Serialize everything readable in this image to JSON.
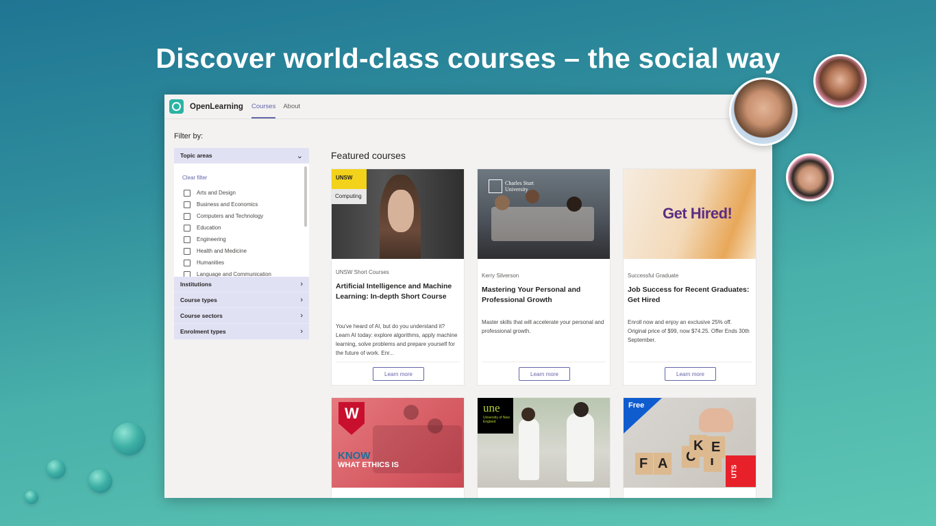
{
  "hero": {
    "title": "Discover world-class courses – the social way"
  },
  "app": {
    "name": "OpenLearning",
    "tabs": [
      "Courses",
      "About"
    ],
    "active_tab": "Courses"
  },
  "filter": {
    "label": "Filter by:",
    "topic": {
      "title": "Topic areas",
      "clear": "Clear filter",
      "options": [
        "Arts and Design",
        "Business and Economics",
        "Computers and Technology",
        "Education",
        "Engineering",
        "Health and Medicine",
        "Humanities",
        "Language and Communication"
      ]
    },
    "collapsed": [
      "Institutions",
      "Course types",
      "Course sectors",
      "Enrolment types"
    ]
  },
  "featured": {
    "title": "Featured courses",
    "cards": [
      {
        "provider": "UNSW Short Courses",
        "title": "Artificial Intelligence and Machine Learning: In-depth Short Course",
        "desc": "You've heard of AI, but do you understand it? Learn AI today: explore algorithms, apply machine learning, solve problems and prepare yourself for the future of work. Enr...",
        "button": "Learn more",
        "badge": "UNSW",
        "badge_sub": "Computing"
      },
      {
        "provider": "Kerry Silverson",
        "title": "Mastering Your Personal and Professional Growth",
        "desc": "Master skills that will accelerate your personal and professional growth.",
        "button": "Learn more",
        "badge": "Charles Sturt University"
      },
      {
        "provider": "Successful Graduate",
        "title": "Job Success for Recent Graduates: Get Hired",
        "desc": "Enroll now and enjoy an exclusive 25% off. Original price of $99, now $74.25. Offer Ends 30th September.",
        "button": "Learn more",
        "badge": "Get Hired!"
      },
      {
        "badge": "W",
        "overlay1": "KNOW",
        "overlay2": "WHAT ETHICS IS"
      },
      {
        "badge": "une",
        "badge_sub": "University of New England"
      },
      {
        "badge": "Free",
        "tiles": [
          "F",
          "A",
          "C",
          "T"
        ],
        "tiles_top": [
          "K",
          "E"
        ],
        "uts": "UTS"
      }
    ]
  },
  "colors": {
    "accent": "#6264a7",
    "facet_bg": "#e1e1f4",
    "brand_teal": "#2bb3a3"
  }
}
